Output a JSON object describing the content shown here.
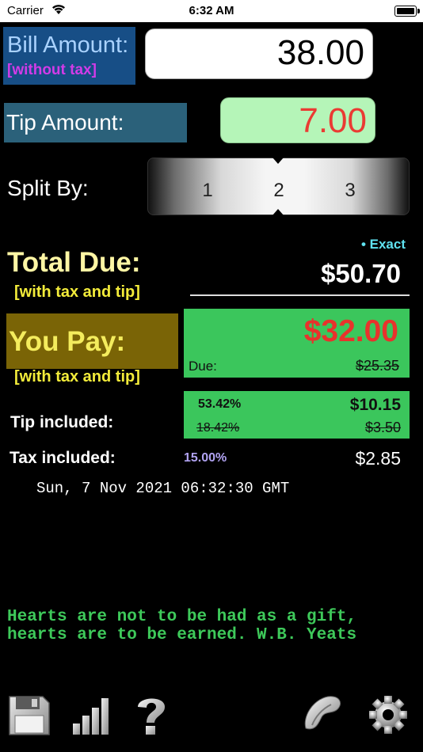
{
  "status_bar": {
    "carrier": "Carrier",
    "time": "6:32 AM"
  },
  "bill": {
    "label": "Bill Amount:",
    "sublabel": "[without tax]",
    "value": "38.00"
  },
  "tip": {
    "label": "Tip Amount:",
    "value": "7.00"
  },
  "split": {
    "label": "Split By:",
    "options": [
      "1",
      "2",
      "3"
    ],
    "selected": "2"
  },
  "total_due": {
    "mode": "• Exact",
    "label": "Total Due:",
    "sublabel": "[with tax and tip]",
    "value": "$50.70"
  },
  "you_pay": {
    "label": "You Pay:",
    "sublabel": "[with tax and tip]",
    "value": "$32.00",
    "due_label": "Due:",
    "due_value": "$25.35"
  },
  "tip_included": {
    "label": "Tip included:",
    "percent": "53.42%",
    "amount": "$10.15",
    "old_percent": "18.42%",
    "old_amount": "$3.50"
  },
  "tax_included": {
    "label": "Tax included:",
    "percent": "15.00%",
    "amount": "$2.85"
  },
  "date": "Sun, 7 Nov 2021 06:32:30 GMT",
  "quote": {
    "line1": "Hearts are not to be had as a gift,",
    "line2": "hearts are to be earned. W.B. Yeats"
  },
  "toolbar": {
    "icons": [
      "save-icon",
      "stats-icon",
      "help-icon",
      "fortune-cookie-icon",
      "settings-icon"
    ]
  },
  "colors": {
    "background": "#000000",
    "bill_box": "#174e86",
    "tip_box": "#2b617a",
    "green_panel": "#3bc65c",
    "pay_box": "#7a6406",
    "red_value": "#e8322c",
    "quote": "#3ec95a"
  }
}
